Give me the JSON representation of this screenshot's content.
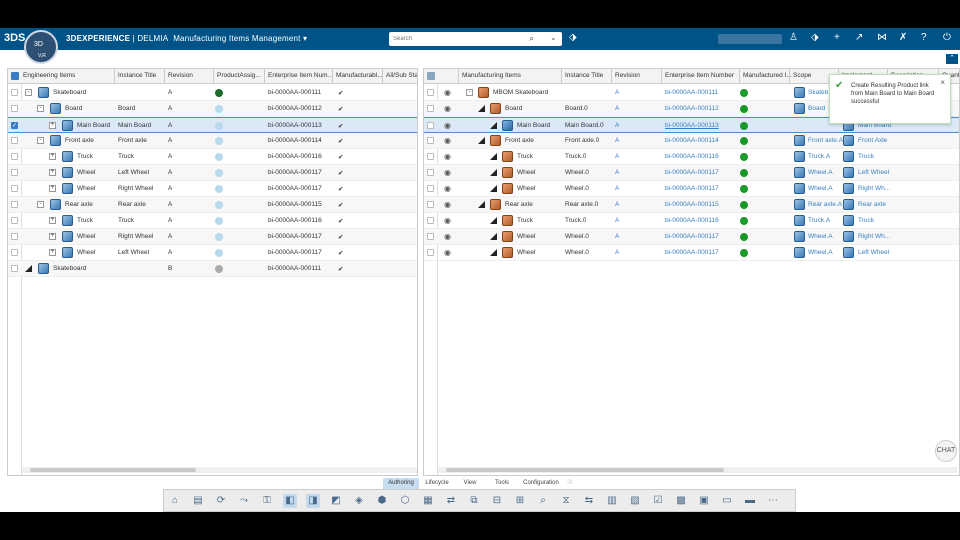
{
  "header": {
    "brand_bold": "3DEXPERIENCE",
    "brand_sep": " | ",
    "brand_app": "DELMIA",
    "app_name": "Manufacturing Items Management",
    "compass_label": "3D",
    "compass_version": "V,R",
    "search_placeholder": "Search",
    "icons": [
      "tag-icon",
      "user-icon",
      "share-tag-icon",
      "add-icon",
      "share-icon",
      "network-icon",
      "tools-icon",
      "help-icon",
      "power-icon"
    ]
  },
  "left": {
    "columns": [
      "Engineering Items",
      "Instance Title",
      "Revision",
      "ProductAssig...",
      "Enterprise Item Num...",
      "Manufacturabl...",
      "All/Sub Stat"
    ],
    "rows": [
      {
        "level": 0,
        "exp": "-",
        "title": "Skateboard",
        "instance": "",
        "rev": "A",
        "assign": "#1b6b2a",
        "ein": "bi-0000AA-000111",
        "check": "✔",
        "checked": false,
        "sel": false
      },
      {
        "level": 1,
        "exp": "-",
        "title": "Board",
        "instance": "Board",
        "rev": "A",
        "assign": "#b9d9ec",
        "ein": "bi-0000AA-000112",
        "check": "✔",
        "checked": false,
        "sel": false
      },
      {
        "level": 2,
        "exp": "+",
        "title": "Main Board",
        "instance": "Main Board",
        "rev": "A",
        "assign": "#b9d9ec",
        "ein": "bi-0000AA-000113",
        "check": "✔",
        "checked": true,
        "sel": true
      },
      {
        "level": 1,
        "exp": "-",
        "title": "Front axle",
        "instance": "Front axle",
        "rev": "A",
        "assign": "#b9d9ec",
        "ein": "bi-0000AA-000114",
        "check": "✔",
        "checked": false,
        "sel": false
      },
      {
        "level": 2,
        "exp": "+",
        "title": "Truck",
        "instance": "Truck",
        "rev": "A",
        "assign": "#b9d9ec",
        "ein": "bi-0000AA-000116",
        "check": "✔",
        "checked": false,
        "sel": false
      },
      {
        "level": 2,
        "exp": "+",
        "title": "Wheel",
        "instance": "Left Wheel",
        "rev": "A",
        "assign": "#b9d9ec",
        "ein": "bi-0000AA-000117",
        "check": "✔",
        "checked": false,
        "sel": false
      },
      {
        "level": 2,
        "exp": "+",
        "title": "Wheel",
        "instance": "Right Wheel",
        "rev": "A",
        "assign": "#b9d9ec",
        "ein": "bi-0000AA-000117",
        "check": "✔",
        "checked": false,
        "sel": false
      },
      {
        "level": 1,
        "exp": "-",
        "title": "Rear axle",
        "instance": "Rear axle",
        "rev": "A",
        "assign": "#b9d9ec",
        "ein": "bi-0000AA-000115",
        "check": "✔",
        "checked": false,
        "sel": false
      },
      {
        "level": 2,
        "exp": "+",
        "title": "Truck",
        "instance": "Truck",
        "rev": "A",
        "assign": "#b9d9ec",
        "ein": "bi-0000AA-000116",
        "check": "✔",
        "checked": false,
        "sel": false
      },
      {
        "level": 2,
        "exp": "+",
        "title": "Wheel",
        "instance": "Right Wheel",
        "rev": "A",
        "assign": "#b9d9ec",
        "ein": "bi-0000AA-000117",
        "check": "✔",
        "checked": false,
        "sel": false
      },
      {
        "level": 2,
        "exp": "+",
        "title": "Wheel",
        "instance": "Left Wheel",
        "rev": "A",
        "assign": "#b9d9ec",
        "ein": "bi-0000AA-000117",
        "check": "✔",
        "checked": false,
        "sel": false
      },
      {
        "level": 0,
        "exp": "tri",
        "title": "Skateboard",
        "instance": "",
        "rev": "B",
        "assign": "#aaaaaa",
        "ein": "bi-0000AA-000111",
        "check": "✔",
        "checked": false,
        "sel": false
      }
    ]
  },
  "right": {
    "columns": [
      "Manufacturing Items",
      "Instance Title",
      "Revision",
      "Enterprise Item Number",
      "Manufactured I...",
      "Scope",
      "Implement...",
      "Description",
      "Quant..."
    ],
    "rows": [
      {
        "level": 0,
        "exp": "-",
        "mfg": true,
        "title": "MBOM Skateboard",
        "instance": "",
        "rev": "A",
        "ein": "bi-0000AA-000111",
        "underline": false,
        "status": "#1a9a2a",
        "scope": "Skateb...",
        "impl": "",
        "sel": false
      },
      {
        "level": 1,
        "exp": "tri",
        "mfg": true,
        "title": "Board",
        "instance": "Board.0",
        "rev": "A",
        "ein": "bi-0000AA-000112",
        "underline": false,
        "status": "#1a9a2a",
        "scope": "Board",
        "impl": "",
        "sel": false
      },
      {
        "level": 2,
        "exp": "tri",
        "mfg": false,
        "title": "Main Board",
        "instance": "Main Board.0",
        "rev": "A",
        "ein": "bi-0000AA-000113",
        "underline": true,
        "status": "#1a9a2a",
        "scope": "",
        "impl": "Main Board",
        "sel": true
      },
      {
        "level": 1,
        "exp": "tri",
        "mfg": true,
        "title": "Front axle",
        "instance": "Front axle.0",
        "rev": "A",
        "ein": "bi-0000AA-000114",
        "underline": false,
        "status": "#1a9a2a",
        "scope": "Front axle.A",
        "impl": "Front Axle",
        "sel": false
      },
      {
        "level": 2,
        "exp": "tri",
        "mfg": true,
        "title": "Truck",
        "instance": "Truck.0",
        "rev": "A",
        "ein": "bi-0000AA-000116",
        "underline": false,
        "status": "#1a9a2a",
        "scope": "Truck.A",
        "impl": "Truck",
        "sel": false
      },
      {
        "level": 2,
        "exp": "tri",
        "mfg": true,
        "title": "Wheel",
        "instance": "Wheel.0",
        "rev": "A",
        "ein": "bi-0000AA-000117",
        "underline": false,
        "status": "#1a9a2a",
        "scope": "Wheel.A",
        "impl": "Left Wheel",
        "sel": false
      },
      {
        "level": 2,
        "exp": "tri",
        "mfg": true,
        "title": "Wheel",
        "instance": "Wheel.0",
        "rev": "A",
        "ein": "bi-0000AA-000117",
        "underline": false,
        "status": "#1a9a2a",
        "scope": "Wheel.A",
        "impl": "Right Wh...",
        "sel": false
      },
      {
        "level": 1,
        "exp": "tri",
        "mfg": true,
        "title": "Rear axle",
        "instance": "Rear axle.0",
        "rev": "A",
        "ein": "bi-0000AA-000115",
        "underline": false,
        "status": "#1a9a2a",
        "scope": "Rear axle.A",
        "impl": "Rear axle",
        "sel": false
      },
      {
        "level": 2,
        "exp": "tri",
        "mfg": true,
        "title": "Truck",
        "instance": "Truck.0",
        "rev": "A",
        "ein": "bi-0000AA-000116",
        "underline": false,
        "status": "#1a9a2a",
        "scope": "Truck.A",
        "impl": "Truck",
        "sel": false
      },
      {
        "level": 2,
        "exp": "tri",
        "mfg": true,
        "title": "Wheel",
        "instance": "Wheel.0",
        "rev": "A",
        "ein": "bi-0000AA-000117",
        "underline": false,
        "status": "#1a9a2a",
        "scope": "Wheel.A",
        "impl": "Right Wh...",
        "sel": false
      },
      {
        "level": 2,
        "exp": "tri",
        "mfg": true,
        "title": "Wheel",
        "instance": "Wheel.0",
        "rev": "A",
        "ein": "bi-0000AA-000117",
        "underline": false,
        "status": "#1a9a2a",
        "scope": "Wheel.A",
        "impl": "Left Wheel",
        "sel": false
      }
    ]
  },
  "toast": {
    "message": "Create Resulting Product link from Main Board to Main Board successful",
    "close": "×"
  },
  "bottom_tabs": [
    "Authoring",
    "Lifecycle",
    "View",
    "Tools",
    "Configuration"
  ],
  "active_tab": "Authoring",
  "action_icons": [
    "home-icon",
    "structure-icon",
    "sync-icon",
    "link-icon",
    "assign-icon",
    "product-icon",
    "product-alt-icon",
    "product-grey-icon",
    "scope-icon",
    "mfg-item-icon",
    "insert-icon",
    "group-icon",
    "replace-icon",
    "compare-icon",
    "split-icon",
    "explode-icon",
    "search-structure-icon",
    "filter-icon",
    "swap-icon",
    "report-icon",
    "tree-icon",
    "check-icon",
    "table-icon",
    "panel-icon",
    "layout-icon",
    "bar-icon",
    "more-icon"
  ],
  "chat_label": "CHAT"
}
